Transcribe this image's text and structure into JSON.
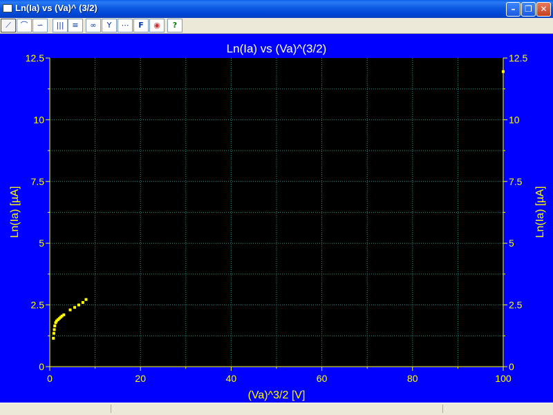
{
  "window": {
    "title": "Ln(Ia) vs (Va)^ (3/2)",
    "buttons": {
      "minimize": "–",
      "restore": "❐",
      "close": "✕"
    }
  },
  "toolbar": {
    "items": [
      {
        "icon": "line-chart-icon",
        "glyph": "⟋"
      },
      {
        "icon": "curve-chart-icon",
        "glyph": "⌒"
      },
      {
        "icon": "smooth-chart-icon",
        "glyph": "∽"
      },
      {
        "icon": "vertical-bars-icon",
        "glyph": "|||"
      },
      {
        "icon": "horizontal-bars-icon",
        "glyph": "≡"
      },
      {
        "icon": "binoculars-icon",
        "glyph": "∞"
      },
      {
        "icon": "funnel-icon",
        "glyph": "Y"
      },
      {
        "icon": "grid-icon",
        "glyph": "⋯"
      },
      {
        "icon": "font-icon",
        "glyph": "F"
      },
      {
        "icon": "color-palette-icon",
        "glyph": "◉"
      },
      {
        "icon": "help-icon",
        "glyph": "?"
      }
    ]
  },
  "colors": {
    "background": "#0000ff",
    "plot_area": "#000000",
    "text": "#ffff00",
    "grid": "#2a9a8a",
    "points": "#ffff00"
  },
  "chart_data": {
    "type": "scatter",
    "title": "Ln(Ia) vs (Va)^(3/2)",
    "xlabel": "(Va)^3/2 [V]",
    "ylabel": "Ln(Ia) [µA]",
    "ylabel_right": "Ln(Ia) [µA]",
    "xlim": [
      0,
      100
    ],
    "ylim": [
      0,
      12.5
    ],
    "x_ticks": [
      "0",
      "20",
      "40",
      "60",
      "80",
      "100"
    ],
    "y_ticks": [
      "0",
      "2.5",
      "5",
      "7.5",
      "10",
      "12.5"
    ],
    "grid": true,
    "x": [
      0.8,
      0.9,
      1.0,
      1.1,
      1.3,
      1.5,
      1.8,
      2.1,
      2.4,
      2.7,
      3.1,
      4.5,
      5.5,
      6.4,
      7.3,
      8.0,
      100
    ],
    "y": [
      1.15,
      1.35,
      1.5,
      1.65,
      1.78,
      1.85,
      1.9,
      1.95,
      2.0,
      2.05,
      2.1,
      2.3,
      2.4,
      2.5,
      2.6,
      2.72,
      11.95
    ]
  }
}
